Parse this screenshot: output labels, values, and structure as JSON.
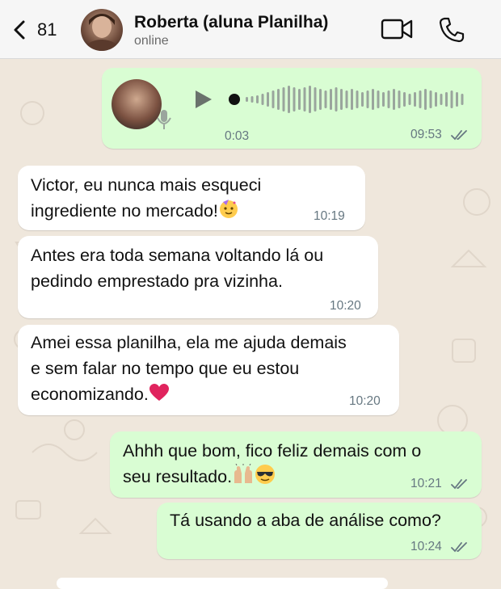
{
  "header": {
    "back_count": "81",
    "contact_name": "Roberta (aluna Planilha)",
    "status": "online"
  },
  "voice_note": {
    "duration": "0:03",
    "time": "09:53",
    "progress": 0
  },
  "messages": [
    {
      "text_line1": "Victor, eu nunca mais esqueci",
      "text_line2": "ingrediente no mercado!",
      "emoji": "party-face",
      "time": "10:19"
    },
    {
      "text_line1": "Antes era toda semana voltando lá ou",
      "text_line2": "pedindo emprestado pra vizinha.",
      "time": "10:20"
    },
    {
      "text_line1": "Amei essa planilha, ela me ajuda demais",
      "text_line2": "e sem falar no tempo que eu estou",
      "text_line3": "economizando.",
      "emoji": "red-heart",
      "time": "10:20"
    },
    {
      "text_line1": "Ahhh que bom, fico feliz demais com o",
      "text_line2": "seu resultado.",
      "emoji": "raising-hands sunglasses-face",
      "time": "10:21"
    },
    {
      "text_line1": "Tá usando a aba de análise como?",
      "time": "10:24"
    }
  ],
  "colors": {
    "background": "#efe7dc",
    "outgoing": "#d9fdd3",
    "incoming": "#ffffff",
    "heart": "#e0245e"
  }
}
